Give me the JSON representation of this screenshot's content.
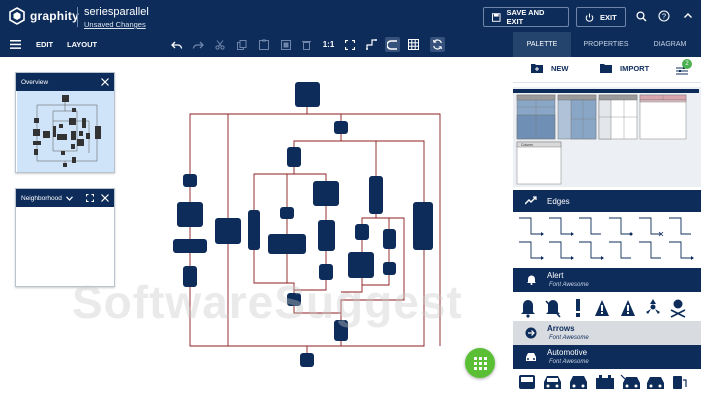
{
  "app": {
    "name": "graphity",
    "project": "seriesparallel",
    "status": "Unsaved Changes"
  },
  "header": {
    "save_exit": "SAVE AND EXIT",
    "exit": "EXIT"
  },
  "toolbar": {
    "edit": "EDIT",
    "layout": "LAYOUT",
    "zoom_reset": "1:1"
  },
  "tabs": [
    {
      "label": "PALETTE",
      "active": true
    },
    {
      "label": "PROPERTIES"
    },
    {
      "label": "DIAGRAM"
    }
  ],
  "overview": {
    "title": "Overview"
  },
  "neighborhood": {
    "title": "Neighborhood"
  },
  "palette": {
    "new": "NEW",
    "import": "IMPORT",
    "badge": "2",
    "tables": [
      {
        "label": "Column"
      }
    ],
    "sections": [
      {
        "title": "Edges",
        "subtitle": ""
      },
      {
        "title": "Alert",
        "subtitle": "Font Awesome"
      },
      {
        "title": "Arrows",
        "subtitle": "Font Awesome"
      },
      {
        "title": "Automotive",
        "subtitle": "Font Awesome"
      }
    ]
  },
  "colors": {
    "primary": "#0d2c5a",
    "node": "#0d2c5a",
    "edge": "#8c1c1c",
    "accent": "#5bbf35",
    "badge": "#4caf50"
  },
  "watermark": "SoftwareSuggest"
}
